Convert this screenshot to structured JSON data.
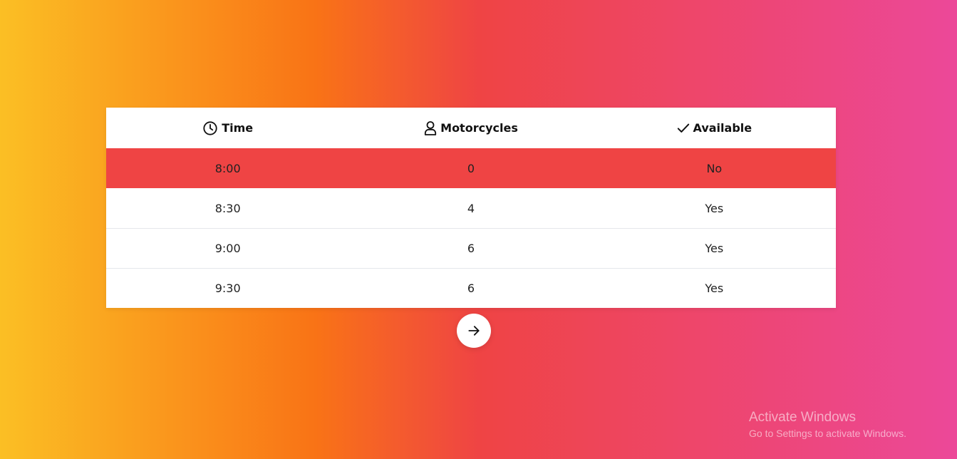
{
  "table": {
    "headers": {
      "time": {
        "label": "Time",
        "icon": "clock-icon"
      },
      "motorcycles": {
        "label": "Motorcycles",
        "icon": "user-icon"
      },
      "available": {
        "label": "Available",
        "icon": "check-icon"
      }
    },
    "rows": [
      {
        "time": "8:00",
        "motorcycles": "0",
        "available": "No"
      },
      {
        "time": "8:30",
        "motorcycles": "4",
        "available": "Yes"
      },
      {
        "time": "9:00",
        "motorcycles": "6",
        "available": "Yes"
      },
      {
        "time": "9:30",
        "motorcycles": "6",
        "available": "Yes"
      }
    ],
    "unavailable_color": "#ef4444"
  },
  "next_button": {
    "icon": "arrow-right-icon"
  },
  "watermark": {
    "title": "Activate Windows",
    "subtitle": "Go to Settings to activate Windows."
  },
  "colors": {
    "gradient_start": "#fbbf24",
    "gradient_mid": "#ef4444",
    "gradient_end": "#ec4899"
  }
}
